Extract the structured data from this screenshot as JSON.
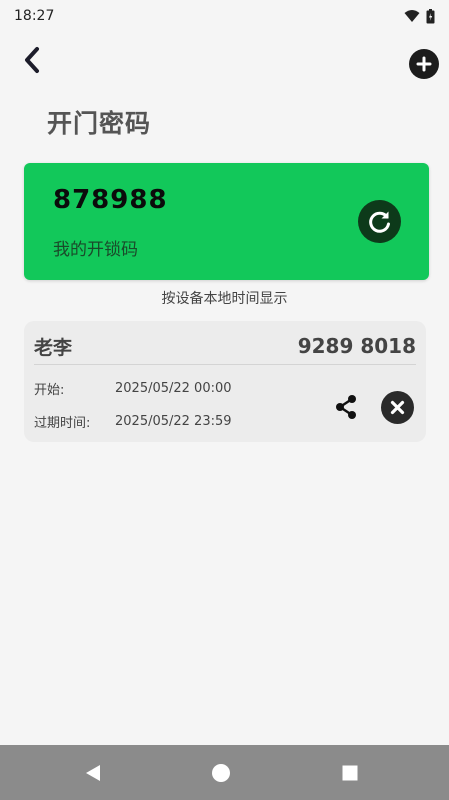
{
  "status_bar": {
    "time": "18:27",
    "icons": [
      "wifi-icon",
      "battery-icon"
    ]
  },
  "header": {
    "back_icon": "chevron-left-icon",
    "add_icon": "plus-circle-icon"
  },
  "page_title": "开门密码",
  "unlock_code": {
    "code": "878988",
    "label": "我的开锁码",
    "refresh_icon": "refresh-icon",
    "background_color": "#12c85a"
  },
  "hint": "按设备本地时间显示",
  "entries": [
    {
      "name": "老李",
      "code": "9289 8018",
      "start_label": "开始:",
      "start_time": "2025/05/22 00:00",
      "expire_label": "过期时间:",
      "expire_time": "2025/05/22 23:59",
      "share_icon": "share-icon",
      "delete_icon": "close-circle-icon"
    }
  ],
  "nav_bar": {
    "icons": [
      "back-triangle-icon",
      "home-circle-icon",
      "recents-square-icon"
    ]
  }
}
